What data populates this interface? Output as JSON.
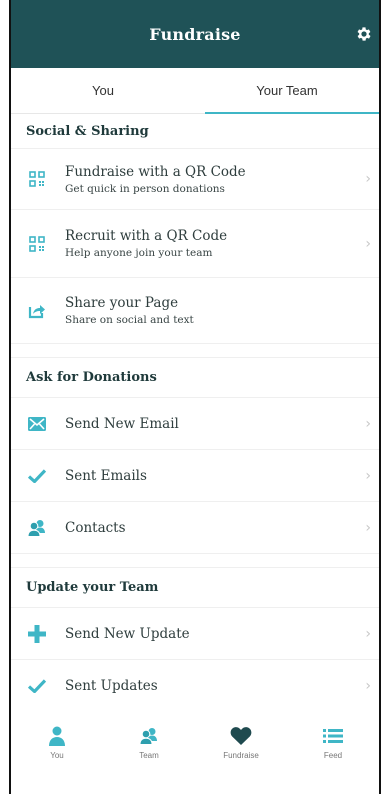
{
  "header": {
    "title": "Fundraise",
    "settings_icon": "gear-icon"
  },
  "tabs": [
    {
      "label": "You",
      "active": false
    },
    {
      "label": "Your Team",
      "active": true
    }
  ],
  "sections": {
    "social": {
      "title": "Social & Sharing",
      "items": [
        {
          "label": "Fundraise with a QR Code",
          "sub": "Get quick in person donations",
          "icon": "qr-code-icon"
        },
        {
          "label": "Recruit with a QR Code",
          "sub": "Help anyone join your team",
          "icon": "qr-code-icon"
        },
        {
          "label": "Share your Page",
          "sub": "Share on social and text",
          "icon": "share-icon"
        }
      ]
    },
    "donations": {
      "title": "Ask for Donations",
      "items": [
        {
          "label": "Send New Email",
          "icon": "email-icon"
        },
        {
          "label": "Sent Emails",
          "icon": "checkmark-icon"
        },
        {
          "label": "Contacts",
          "icon": "contacts-icon"
        }
      ]
    },
    "team": {
      "title": "Update your Team",
      "items": [
        {
          "label": "Send New Update",
          "icon": "plus-icon"
        },
        {
          "label": "Sent Updates",
          "icon": "checkmark-icon"
        }
      ]
    }
  },
  "bottom_nav": [
    {
      "label": "You",
      "icon": "person-icon"
    },
    {
      "label": "Team",
      "icon": "team-icon"
    },
    {
      "label": "Fundraise",
      "icon": "heart-icon"
    },
    {
      "label": "Feed",
      "icon": "list-icon"
    }
  ],
  "colors": {
    "header_bg": "#1f5257",
    "accent": "#3fb6c6",
    "icon_teal": "#3fb6c6",
    "heart": "#1f4a4f"
  }
}
